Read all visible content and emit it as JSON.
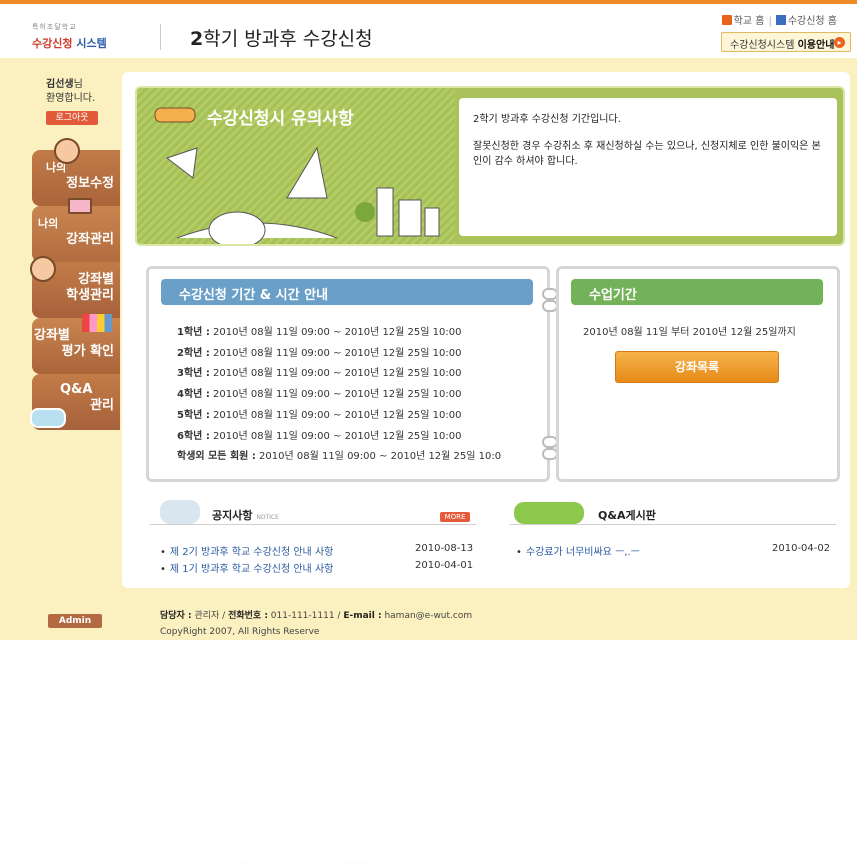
{
  "header": {
    "logo_small": "특허조달학교",
    "logo_main": "수강신청",
    "logo_main_b": "시스템",
    "title_num": "2",
    "title_rest": "학기 방과후 수강신청",
    "link_school_home": "학교 홈",
    "link_course_home": "수강신청 홈",
    "guide_label_a": "수강신청시스템",
    "guide_label_b": "이용안내"
  },
  "sidebar": {
    "greeting_name": "김선생",
    "greeting_suffix": "님",
    "greeting_line2": "환영합니다.",
    "logout_label": "로그아웃",
    "items": [
      {
        "line1": "나의",
        "line2": "정보수정"
      },
      {
        "line1": "나의",
        "line2": "강좌관리"
      },
      {
        "line1": "강좌별",
        "line2": "학생관리"
      },
      {
        "line1": "강좌별",
        "line2": "평가 확인"
      },
      {
        "line1": "Q&A",
        "line2": "관리"
      }
    ],
    "admin_label": "Admin"
  },
  "notice": {
    "title": "수강신청시 유의사항",
    "line1": "2학기 방과후 수강신청 기간입니다.",
    "line2": "잘못신청한 경우 수강취소 후 재신청하실 수는 있으나, 신청지체로 인한 불이익은 본인이 감수 하셔야 합니다."
  },
  "period": {
    "title": "수강신청 기간 & 시간 안내",
    "rows": [
      {
        "label": "1학년 :",
        "text": "2010년 08월 11일 09:00 ~ 2010년 12월 25일 10:00"
      },
      {
        "label": "2학년 :",
        "text": "2010년 08월 11일 09:00 ~ 2010년 12월 25일 10:00"
      },
      {
        "label": "3학년 :",
        "text": "2010년 08월 11일 09:00 ~ 2010년 12월 25일 10:00"
      },
      {
        "label": "4학년 :",
        "text": "2010년 08월 11일 09:00 ~ 2010년 12월 25일 10:00"
      },
      {
        "label": "5학년 :",
        "text": "2010년 08월 11일 09:00 ~ 2010년 12월 25일 10:00"
      },
      {
        "label": "6학년 :",
        "text": "2010년 08월 11일 09:00 ~ 2010년 12월 25일 10:00"
      },
      {
        "label": "학생외 모든 회원 :",
        "text": "2010년 08월 11일 09:00 ~ 2010년 12월 25일 10:0"
      }
    ]
  },
  "class_period": {
    "title": "수업기간",
    "text": "2010년 08월 11일 부터 2010년 12월 25일까지",
    "button": "강좌목록"
  },
  "board_notice": {
    "title": "공지사항",
    "subtitle": "NOTICE",
    "more": "MORE",
    "items": [
      {
        "title": "제 2기 방과후 학교 수강신청 안내 사항",
        "date": "2010-08-13"
      },
      {
        "title": "제 1기 방과후 학교 수강신청 안내 사항",
        "date": "2010-04-01"
      }
    ]
  },
  "board_qa": {
    "title": "Q&A게시판",
    "items": [
      {
        "title": "수강료가 너무비싸요 ㅡ,.ㅡ",
        "date": "2010-04-02"
      }
    ]
  },
  "footer": {
    "manager_label": "담당자 :",
    "manager": "관리자",
    "phone_label": "전화번호 :",
    "phone": "011-111-1111",
    "email_label": "E-mail :",
    "email": "haman@e-wut.com",
    "copyright": "CopyRight 2007, All Rights Reserve"
  },
  "colors": {
    "accent_orange": "#f08a24",
    "band": "#fbf0c0",
    "green": "#74b25a",
    "blue": "#6aa0c8"
  }
}
